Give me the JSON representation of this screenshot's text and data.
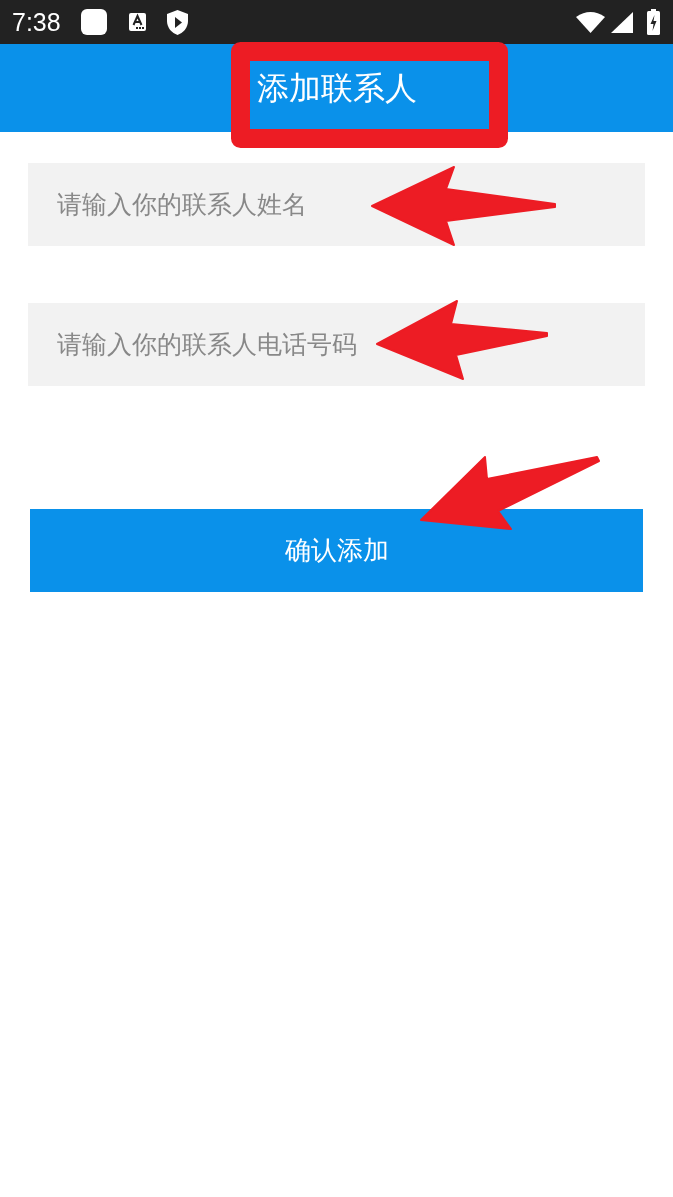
{
  "status_bar": {
    "time": "7:38"
  },
  "app_bar": {
    "title": "添加联系人"
  },
  "form": {
    "fields": [
      {
        "placeholder": "请输入你的联系人姓名"
      },
      {
        "placeholder": "请输入你的联系人电话号码"
      }
    ],
    "submit_button": {
      "label": "确认添加"
    }
  }
}
